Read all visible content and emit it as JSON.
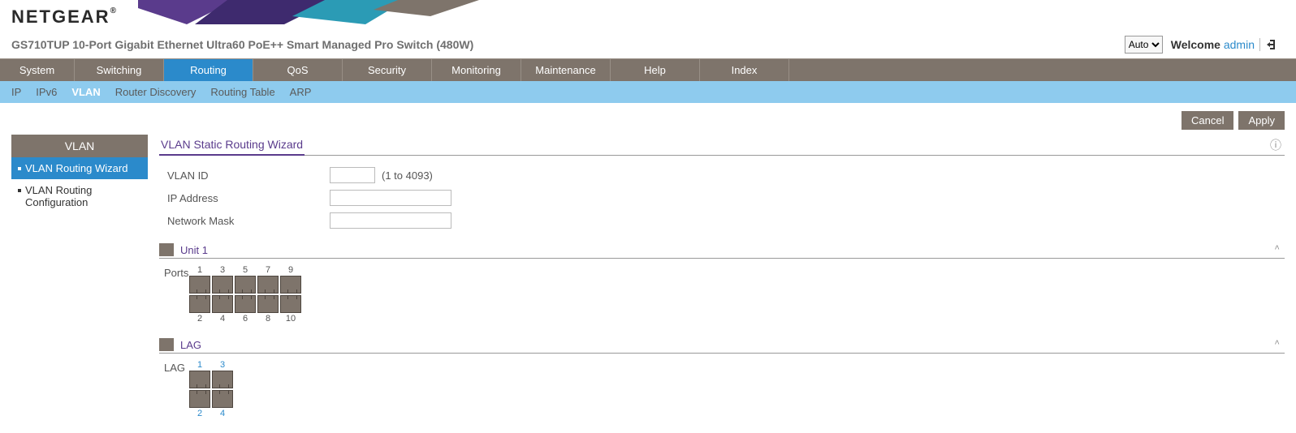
{
  "brand": "NETGEAR",
  "model": "GS710TUP 10-Port Gigabit Ethernet Ultra60 PoE++ Smart Managed Pro Switch (480W)",
  "mode_select": {
    "selected": "Auto",
    "options": [
      "Auto"
    ]
  },
  "welcome": {
    "prefix": "Welcome ",
    "user": "admin"
  },
  "main_nav": [
    "System",
    "Switching",
    "Routing",
    "QoS",
    "Security",
    "Monitoring",
    "Maintenance",
    "Help",
    "Index"
  ],
  "main_nav_active": "Routing",
  "sub_nav": [
    "IP",
    "IPv6",
    "VLAN",
    "Router Discovery",
    "Routing Table",
    "ARP"
  ],
  "sub_nav_active": "VLAN",
  "buttons": {
    "cancel": "Cancel",
    "apply": "Apply"
  },
  "sidebar": {
    "header": "VLAN",
    "items": [
      {
        "label": "VLAN Routing Wizard",
        "active": true
      },
      {
        "label": "VLAN Routing Configuration",
        "active": false
      }
    ]
  },
  "panel_title": "VLAN Static Routing Wizard",
  "form": {
    "vlan_id": {
      "label": "VLAN ID",
      "value": "",
      "hint": "(1 to 4093)"
    },
    "ip_address": {
      "label": "IP Address",
      "value": ""
    },
    "network_mask": {
      "label": "Network Mask",
      "value": ""
    }
  },
  "unit_section": {
    "title": "Unit 1",
    "row_label": "Ports",
    "top_numbers": [
      "1",
      "3",
      "5",
      "7",
      "9"
    ],
    "bottom_numbers": [
      "2",
      "4",
      "6",
      "8",
      "10"
    ]
  },
  "lag_section": {
    "title": "LAG",
    "row_label": "LAG",
    "top_numbers": [
      "1",
      "3"
    ],
    "bottom_numbers": [
      "2",
      "4"
    ]
  }
}
